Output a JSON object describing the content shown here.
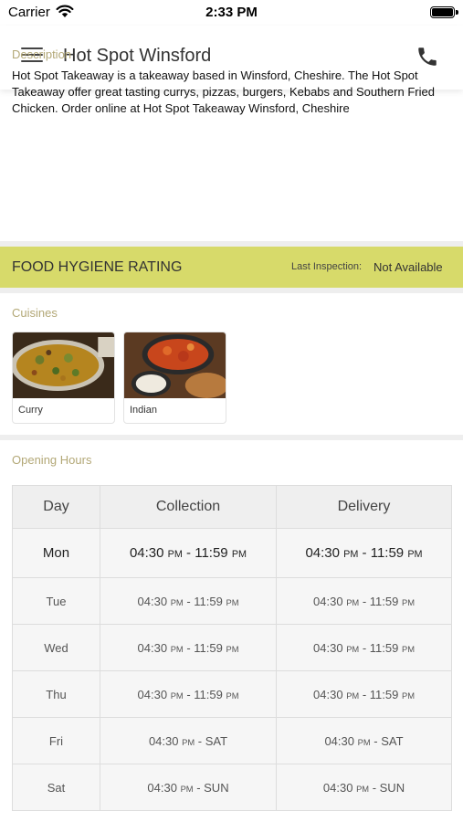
{
  "status_bar": {
    "carrier": "Carrier",
    "time": "2:33 PM"
  },
  "nav": {
    "title": "Hot Spot Winsford"
  },
  "description": {
    "label": "Description",
    "text": "Hot Spot Takeaway is a takeaway based in Winsford, Cheshire. The Hot Spot Takeaway offer great tasting currys, pizzas, burgers, Kebabs and Southern Fried Chicken. Order online at Hot Spot Takeaway Winsford, Cheshire"
  },
  "hygiene": {
    "title": "FOOD HYGIENE RATING",
    "last_inspection_label": "Last Inspection:",
    "last_inspection_value": "Not Available",
    "color": "#d7da6a"
  },
  "cuisines": {
    "label": "Cuisines",
    "items": [
      {
        "name": "Curry"
      },
      {
        "name": "Indian"
      }
    ]
  },
  "opening_hours": {
    "label": "Opening Hours",
    "headers": [
      "Day",
      "Collection",
      "Delivery"
    ],
    "rows": [
      {
        "day": "Mon",
        "collection_start": "04:30",
        "collection_start_ampm": "PM",
        "collection_end": "11:59",
        "collection_end_ampm": "PM",
        "delivery_start": "04:30",
        "delivery_start_ampm": "PM",
        "delivery_end": "11:59",
        "delivery_end_ampm": "PM"
      },
      {
        "day": "Tue",
        "collection_start": "04:30",
        "collection_start_ampm": "PM",
        "collection_end": "11:59",
        "collection_end_ampm": "PM",
        "delivery_start": "04:30",
        "delivery_start_ampm": "PM",
        "delivery_end": "11:59",
        "delivery_end_ampm": "PM"
      },
      {
        "day": "Wed",
        "collection_start": "04:30",
        "collection_start_ampm": "PM",
        "collection_end": "11:59",
        "collection_end_ampm": "PM",
        "delivery_start": "04:30",
        "delivery_start_ampm": "PM",
        "delivery_end": "11:59",
        "delivery_end_ampm": "PM"
      },
      {
        "day": "Thu",
        "collection_start": "04:30",
        "collection_start_ampm": "PM",
        "collection_end": "11:59",
        "collection_end_ampm": "PM",
        "delivery_start": "04:30",
        "delivery_start_ampm": "PM",
        "delivery_end": "11:59",
        "delivery_end_ampm": "PM"
      },
      {
        "day": "Fri",
        "collection_start": "04:30",
        "collection_start_ampm": "PM",
        "collection_end": "SAT",
        "collection_end_ampm": "",
        "delivery_start": "04:30",
        "delivery_start_ampm": "PM",
        "delivery_end": "SAT",
        "delivery_end_ampm": ""
      },
      {
        "day": "Sat",
        "collection_start": "04:30",
        "collection_start_ampm": "PM",
        "collection_end": "SUN",
        "collection_end_ampm": "",
        "delivery_start": "04:30",
        "delivery_start_ampm": "PM",
        "delivery_end": "SUN",
        "delivery_end_ampm": ""
      }
    ]
  }
}
